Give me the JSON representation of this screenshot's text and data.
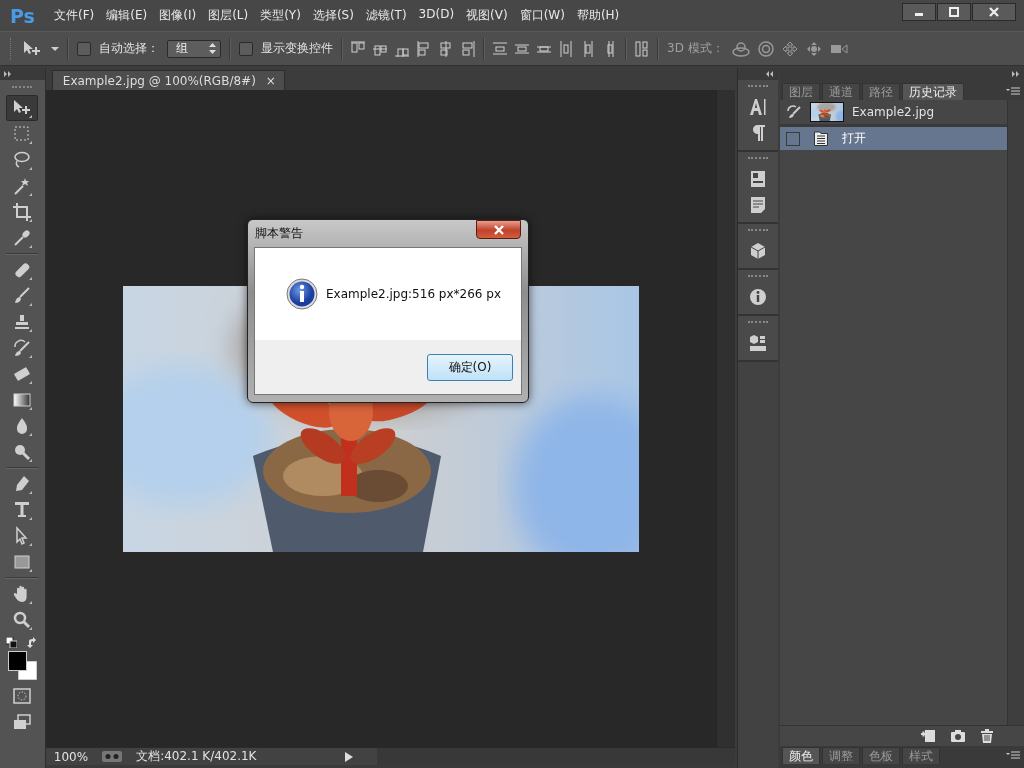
{
  "app": {
    "logo": "Ps"
  },
  "menu": [
    "文件(F)",
    "编辑(E)",
    "图像(I)",
    "图层(L)",
    "类型(Y)",
    "选择(S)",
    "滤镜(T)",
    "3D(D)",
    "视图(V)",
    "窗口(W)",
    "帮助(H)"
  ],
  "options_bar": {
    "auto_select": {
      "label": "自动选择：",
      "checked": false
    },
    "auto_select_target": "组",
    "show_transform": {
      "label": "显示变换控件",
      "checked": false
    },
    "mode_label": "3D 模式："
  },
  "document_tab": {
    "title": "Example2.jpg @ 100%(RGB/8#)",
    "close": "×"
  },
  "tool_groups": [
    {
      "tools": [
        {
          "kind": "move",
          "selected": true
        },
        {
          "kind": "marquee",
          "selected": false
        },
        {
          "kind": "lasso",
          "selected": false
        },
        {
          "kind": "wand",
          "selected": false
        },
        {
          "kind": "crop",
          "selected": false
        },
        {
          "kind": "eyedropper",
          "selected": false
        }
      ]
    },
    {
      "tools": [
        {
          "kind": "healing",
          "selected": false
        },
        {
          "kind": "brush",
          "selected": false
        },
        {
          "kind": "stamp",
          "selected": false
        },
        {
          "kind": "history",
          "selected": false
        },
        {
          "kind": "eraser",
          "selected": false
        },
        {
          "kind": "gradient",
          "selected": false
        },
        {
          "kind": "blur",
          "selected": false
        },
        {
          "kind": "dodge",
          "selected": false
        }
      ]
    },
    {
      "tools": [
        {
          "kind": "pen",
          "selected": false
        },
        {
          "kind": "type",
          "selected": false
        },
        {
          "kind": "path",
          "selected": false
        },
        {
          "kind": "shape",
          "selected": false
        }
      ]
    },
    {
      "tools": [
        {
          "kind": "hand",
          "selected": false
        },
        {
          "kind": "zoom",
          "selected": false
        }
      ]
    }
  ],
  "status_bar": {
    "zoom": "100%",
    "doc_info": "文档:402.1 K/402.1K"
  },
  "dialog": {
    "title": "脚本警告",
    "message": "Example2.jpg:516 px*266 px",
    "button": "确定(O)"
  },
  "panel": {
    "tabs": [
      {
        "label": "图层",
        "selected": false
      },
      {
        "label": "通道",
        "selected": false
      },
      {
        "label": "路径",
        "selected": false
      },
      {
        "label": "历史记录",
        "selected": true
      }
    ],
    "snapshot": "Example2.jpg",
    "history": [
      {
        "label": "打开",
        "selected": true
      }
    ]
  },
  "bottom_panel": {
    "tabs": [
      {
        "label": "颜色",
        "selected": true
      },
      {
        "label": "调整",
        "selected": false
      },
      {
        "label": "色板",
        "selected": false
      },
      {
        "label": "样式",
        "selected": false
      }
    ]
  }
}
